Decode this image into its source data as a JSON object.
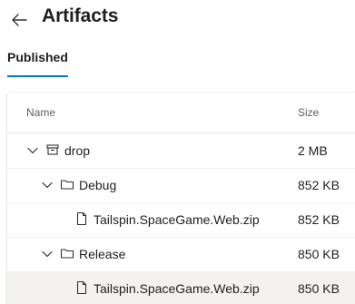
{
  "header": {
    "title": "Artifacts",
    "back_icon": "arrow-left-icon"
  },
  "tabs": [
    {
      "label": "Published",
      "selected": true
    }
  ],
  "accent_color": "#0078d4",
  "table": {
    "columns": {
      "name": "Name",
      "size": "Size"
    },
    "rows": [
      {
        "name": "drop",
        "size": "2 MB",
        "type": "artifact",
        "expanded": true,
        "icon": "artifact-box-icon"
      },
      {
        "name": "Debug",
        "size": "852 KB",
        "type": "folder",
        "expanded": true,
        "icon": "folder-icon"
      },
      {
        "name": "Tailspin.SpaceGame.Web.zip",
        "size": "852 KB",
        "type": "file",
        "icon": "file-icon"
      },
      {
        "name": "Release",
        "size": "850 KB",
        "type": "folder",
        "expanded": true,
        "icon": "folder-icon"
      },
      {
        "name": "Tailspin.SpaceGame.Web.zip",
        "size": "850 KB",
        "type": "file",
        "icon": "file-icon",
        "selected": true
      }
    ]
  }
}
